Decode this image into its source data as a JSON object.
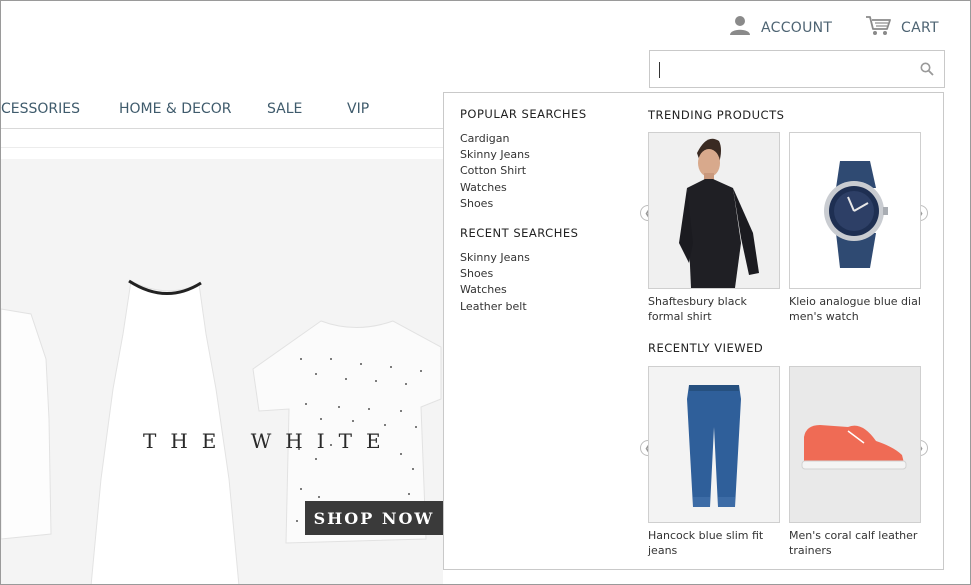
{
  "header": {
    "account_label": "ACCOUNT",
    "cart_label": "CART",
    "icons": {
      "account": "user-icon",
      "cart": "cart-icon",
      "search": "search-icon"
    }
  },
  "search": {
    "value": "",
    "placeholder": ""
  },
  "nav": {
    "items": [
      "CESSORIES",
      "HOME & DECOR",
      "SALE",
      "VIP"
    ]
  },
  "hero": {
    "title": "THE WHITE",
    "cta": "SHOP NOW"
  },
  "dropdown": {
    "popular_title": "POPULAR SEARCHES",
    "popular": [
      "Cardigan",
      "Skinny Jeans",
      "Cotton Shirt",
      "Watches",
      "Shoes"
    ],
    "recent_title": "RECENT SEARCHES",
    "recent": [
      "Skinny Jeans",
      "Shoes",
      "Watches",
      "Leather belt"
    ],
    "trending_title": "TRENDING PRODUCTS",
    "trending": [
      {
        "name": "Shaftesbury black formal shirt"
      },
      {
        "name": "Kleio analogue blue dial men's watch"
      }
    ],
    "recent_viewed_title": "RECENTLY VIEWED",
    "recently_viewed": [
      {
        "name": "Hancock blue slim fit jeans"
      },
      {
        "name": "Men's coral calf leather trainers"
      }
    ]
  },
  "colors": {
    "nav_text": "#3f5b6c",
    "cta_bg": "#3a3a3a",
    "border": "#c9c9c9"
  }
}
